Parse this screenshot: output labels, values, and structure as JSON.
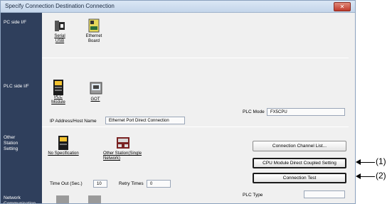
{
  "window": {
    "title": "Specify Connection Destination Connection",
    "close_glyph": "✕"
  },
  "rows": {
    "pc_side": "PC side I/F",
    "plc_side": "PLC side I/F",
    "other_station": "Other\nStation\nSetting",
    "network": "Network\nCommunication"
  },
  "pc_side_items": [
    {
      "label": "Serial\nUSB",
      "icon": "serial-usb-icon"
    },
    {
      "label": "Ethernet\nBoard",
      "icon": "ethernet-board-icon"
    }
  ],
  "plc_side_items": [
    {
      "label": "PLC\nModule",
      "icon": "plc-module-icon"
    },
    {
      "label": "GOT",
      "icon": "got-icon"
    }
  ],
  "plc_mode": {
    "label": "PLC Mode",
    "value": "FX5CPU"
  },
  "ip_address": {
    "label": "IP Address/Host Name",
    "value": "Ethernet Port Direct Connection"
  },
  "other_station_items": [
    {
      "label": "No Specification",
      "icon": "no-specification-icon"
    },
    {
      "label": "Other Station(Single\nNetwork)",
      "icon": "other-station-icon"
    }
  ],
  "buttons": {
    "connection_channel_list": "Connection Channel List...",
    "cpu_direct_coupled": "CPU Module Direct Coupled Setting",
    "connection_test": "Connection Test"
  },
  "timeout": {
    "label": "Time Out (Sec.)",
    "value": "10"
  },
  "retry": {
    "label": "Retry Times",
    "value": "0"
  },
  "plc_type": {
    "label": "PLC Type"
  },
  "callouts": [
    "(1)",
    "(2)"
  ]
}
